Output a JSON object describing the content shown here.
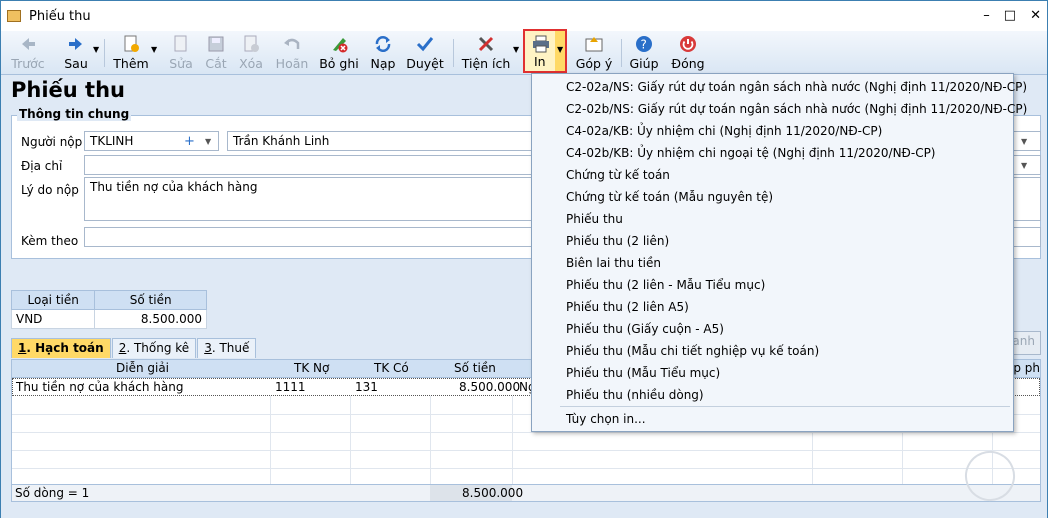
{
  "window": {
    "title": "Phiếu thu",
    "min": "–",
    "max": "□",
    "close": "✕"
  },
  "toolbar": {
    "prev": "Trước",
    "next": "Sau",
    "add": "Thêm",
    "edit": "Sửa",
    "cut": "Cắt",
    "delete": "Xóa",
    "undo": "Hoãn",
    "unpost": "Bỏ ghi",
    "reload": "Nạp",
    "approve": "Duyệt",
    "utilities": "Tiện ích",
    "print": "In",
    "feedback": "Góp ý",
    "help": "Giúp",
    "close": "Đóng"
  },
  "page": {
    "heading": "Phiếu thu"
  },
  "general": {
    "title": "Thông tin chung",
    "payer_label": "Người nộp",
    "payer_code": "TKLINH",
    "payer_name": "Trần Khánh Linh",
    "address_label": "Địa chỉ",
    "address_value": "",
    "reason_label": "Lý do nộp",
    "reason_value": "Thu tiền nợ của khách hàng",
    "attach_label": "Kèm theo",
    "attach_value": ""
  },
  "currency": {
    "col_type": "Loại tiền",
    "col_amount": "Số tiền",
    "type": "VND",
    "amount": "8.500.000"
  },
  "tabs": [
    {
      "num": "1",
      "label": ". Hạch toán"
    },
    {
      "num": "2",
      "label": ". Thống kê"
    },
    {
      "num": "3",
      "label": ". Thuế"
    }
  ],
  "grid": {
    "headers": {
      "desc": "Diễn giải",
      "debit": "TK Nợ",
      "credit": "TK Có",
      "amount": "Số tiền",
      "partial_right": "ấp ph",
      "partial_left": "Ng"
    },
    "row": {
      "desc": "Thu tiền nợ của khách hàng",
      "debit": "1111",
      "credit": "131",
      "amount": "8.500.000"
    },
    "footer": {
      "count": "Số dòng = 1",
      "total": "8.500.000"
    }
  },
  "right_button_partial": "anh",
  "print_menu": {
    "items": [
      "C2-02a/NS: Giấy rút dự toán ngân sách nhà nước (Nghị định 11/2020/NĐ-CP)",
      "C2-02b/NS: Giấy rút dự toán ngân sách nhà nước (Nghị định 11/2020/NĐ-CP)",
      "C4-02a/KB: Ủy nhiệm chi (Nghị định 11/2020/NĐ-CP)",
      "C4-02b/KB: Ủy nhiệm chi ngoại tệ (Nghị định 11/2020/NĐ-CP)",
      "Chứng từ kế toán",
      "Chứng từ kế toán (Mẫu nguyên tệ)",
      "Phiếu thu",
      "Phiếu thu (2 liên)",
      "Biên lai thu tiền",
      "Phiếu thu (2 liên - Mẫu Tiểu mục)",
      "Phiếu thu (2 liên A5)",
      "Phiếu thu (Giấy cuộn - A5)",
      "Phiếu thu (Mẫu chi tiết nghiệp vụ kế toán)",
      "Phiếu thu (Mẫu Tiểu mục)",
      "Phiếu thu (nhiều dòng)"
    ],
    "options": "Tùy chọn in..."
  },
  "colors": {
    "accent": "#ffd966",
    "highlight_border": "#e03030",
    "header_bg": "#cfe0f3"
  }
}
